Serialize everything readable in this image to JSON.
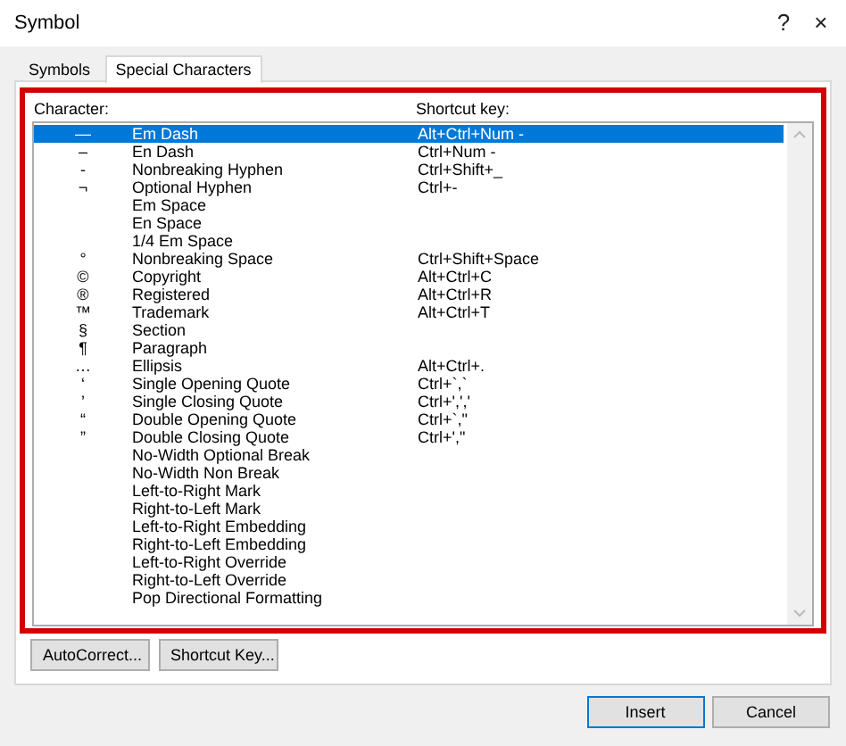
{
  "window": {
    "title": "Symbol",
    "help": "?",
    "close": "×"
  },
  "tabs": [
    {
      "label": "Symbols",
      "selected": false
    },
    {
      "label": "Special Characters",
      "selected": true
    }
  ],
  "list": {
    "highlighted": true,
    "columns": [
      "Character:",
      "Shortcut key:"
    ],
    "rows": [
      {
        "symbol": "—",
        "name": "Em Dash",
        "shortcut": "Alt+Ctrl+Num -",
        "selected": true
      },
      {
        "symbol": "–",
        "name": "En Dash",
        "shortcut": "Ctrl+Num -",
        "selected": false
      },
      {
        "symbol": "-",
        "name": "Nonbreaking Hyphen",
        "shortcut": "Ctrl+Shift+_",
        "selected": false
      },
      {
        "symbol": "¬",
        "name": "Optional Hyphen",
        "shortcut": "Ctrl+-",
        "selected": false
      },
      {
        "name": "Em Space",
        "selected": false
      },
      {
        "name": "En Space",
        "selected": false
      },
      {
        "name": "1/4 Em Space",
        "selected": false
      },
      {
        "symbol": "°",
        "name": "Nonbreaking Space",
        "shortcut": "Ctrl+Shift+Space",
        "selected": false
      },
      {
        "symbol": "©",
        "name": "Copyright",
        "shortcut": "Alt+Ctrl+C",
        "selected": false
      },
      {
        "symbol": "®",
        "name": "Registered",
        "shortcut": "Alt+Ctrl+R",
        "selected": false
      },
      {
        "symbol": "™",
        "name": "Trademark",
        "shortcut": "Alt+Ctrl+T",
        "selected": false
      },
      {
        "symbol": "§",
        "name": "Section",
        "selected": false
      },
      {
        "symbol": "¶",
        "name": "Paragraph",
        "selected": false
      },
      {
        "symbol": "…",
        "name": "Ellipsis",
        "shortcut": "Alt+Ctrl+.",
        "selected": false
      },
      {
        "symbol": "‘",
        "name": "Single Opening Quote",
        "shortcut": "Ctrl+`,`",
        "selected": false
      },
      {
        "symbol": "’",
        "name": "Single Closing Quote",
        "shortcut": "Ctrl+',','",
        "selected": false
      },
      {
        "symbol": "“",
        "name": "Double Opening Quote",
        "shortcut": "Ctrl+`,\"",
        "selected": false
      },
      {
        "symbol": "”",
        "name": "Double Closing Quote",
        "shortcut": "Ctrl+',\"",
        "selected": false
      },
      {
        "name": "No-Width Optional Break",
        "selected": false
      },
      {
        "name": "No-Width Non Break",
        "selected": false
      },
      {
        "name": "Left-to-Right Mark",
        "selected": false
      },
      {
        "name": "Right-to-Left Mark",
        "selected": false
      },
      {
        "name": "Left-to-Right Embedding",
        "selected": false
      },
      {
        "name": "Right-to-Left Embedding",
        "selected": false
      },
      {
        "name": "Left-to-Right Override",
        "selected": false
      },
      {
        "name": "Right-to-Left Override",
        "selected": false
      },
      {
        "name": "Pop Directional Formatting",
        "selected": false
      }
    ]
  },
  "panel_buttons": [
    "AutoCorrect...",
    "Shortcut Key..."
  ],
  "buttons": [
    {
      "label": "Insert",
      "default": true
    },
    {
      "label": "Cancel",
      "default": false
    }
  ]
}
